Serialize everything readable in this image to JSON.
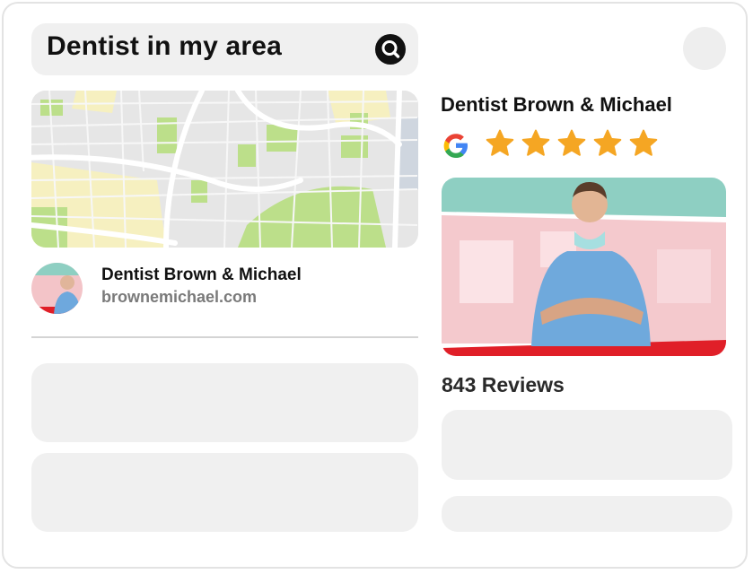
{
  "search": {
    "query": "Dentist in my area",
    "icon": "search-icon"
  },
  "listing": {
    "name": "Dentist Brown & Michael",
    "url": "brownemichael.com"
  },
  "business": {
    "title": "Dentist Brown & Michael",
    "rating_stars": 5,
    "rating_max": 5,
    "reviews_label": "843 Reviews",
    "star_color": "#f5a623"
  },
  "colors": {
    "accent_teal": "#86cfc1",
    "accent_red": "#e01f28",
    "placeholder": "#f0f0f0",
    "map_park": "#b9de86",
    "map_sand": "#f7f1bf"
  }
}
